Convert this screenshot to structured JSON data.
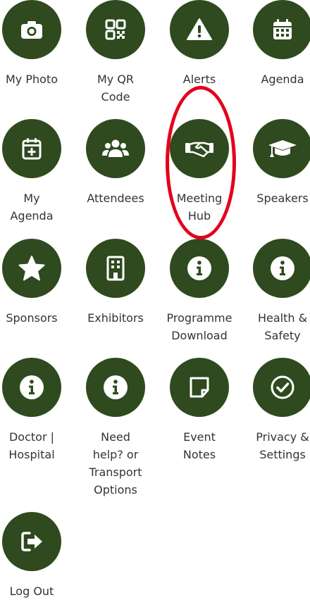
{
  "menu": {
    "items": [
      {
        "label": "My Photo",
        "icon": "camera-icon"
      },
      {
        "label": "My QR\nCode",
        "icon": "qr-code-icon"
      },
      {
        "label": "Alerts",
        "icon": "warning-icon"
      },
      {
        "label": "Agenda",
        "icon": "calendar-icon"
      },
      {
        "label": "My\nAgenda",
        "icon": "calendar-plus-icon"
      },
      {
        "label": "Attendees",
        "icon": "users-icon"
      },
      {
        "label": "Meeting\nHub",
        "icon": "handshake-icon"
      },
      {
        "label": "Speakers",
        "icon": "graduation-cap-icon"
      },
      {
        "label": "Sponsors",
        "icon": "star-icon"
      },
      {
        "label": "Exhibitors",
        "icon": "building-icon"
      },
      {
        "label": "Programme\nDownload",
        "icon": "info-icon"
      },
      {
        "label": "Health &\nSafety",
        "icon": "info-icon"
      },
      {
        "label": "Doctor |\nHospital",
        "icon": "info-icon"
      },
      {
        "label": "Need\nhelp? or\nTransport\nOptions",
        "icon": "info-icon"
      },
      {
        "label": "Event\nNotes",
        "icon": "sticky-note-icon"
      },
      {
        "label": "Privacy &\nSettings",
        "icon": "check-circle-icon"
      },
      {
        "label": "Log Out",
        "icon": "sign-out-icon"
      }
    ]
  },
  "colors": {
    "icon_background": "#2e4a1e",
    "highlight": "#e3001b",
    "label_text": "#333333"
  }
}
